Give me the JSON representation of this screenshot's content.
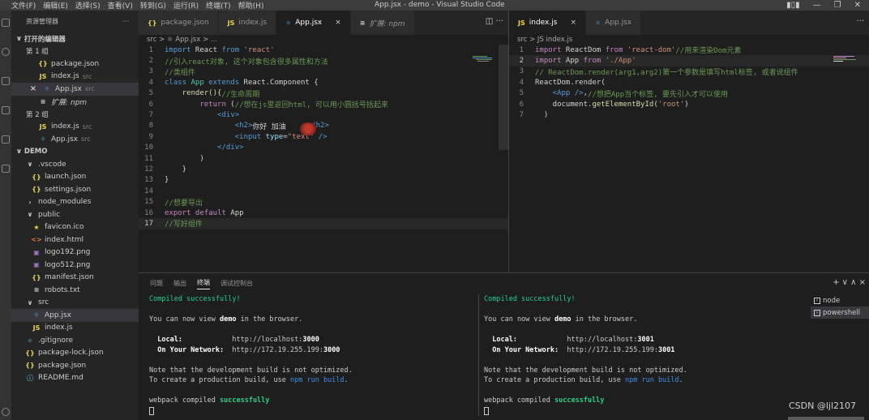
{
  "titlebar": {
    "menus": [
      "文件(F)",
      "编辑(E)",
      "选择(S)",
      "查看(V)",
      "转到(G)",
      "运行(R)",
      "终端(T)",
      "帮助(H)"
    ],
    "title": "App.jsx - demo - Visual Studio Code"
  },
  "sidebar": {
    "header": "资源管理器",
    "more": "···",
    "open_editors": "打开的编辑器",
    "group1": "第 1 组",
    "group1_items": [
      {
        "icon": "{}",
        "name": "package.json",
        "hint": ""
      },
      {
        "icon": "JS",
        "name": "index.js",
        "hint": "src"
      },
      {
        "icon": "×",
        "name": "App.jsx",
        "hint": "src"
      },
      {
        "icon": "≡",
        "name": "扩展: npm",
        "hint": ""
      }
    ],
    "group2": "第 2 组",
    "group2_items": [
      {
        "icon": "JS",
        "name": "index.js",
        "hint": "src"
      },
      {
        "icon": "⚛",
        "name": "App.jsx",
        "hint": "src"
      }
    ],
    "project": "DEMO",
    "tree": [
      {
        "icon": "∨",
        "name": ".vscode"
      },
      {
        "icon": "{}",
        "name": "launch.json"
      },
      {
        "icon": "{}",
        "name": "settings.json"
      },
      {
        "icon": "›",
        "name": "node_modules"
      },
      {
        "icon": "∨",
        "name": "public"
      },
      {
        "icon": "★",
        "name": "favicon.ico"
      },
      {
        "icon": "<>",
        "name": "index.html"
      },
      {
        "icon": "▣",
        "name": "logo192.png"
      },
      {
        "icon": "▣",
        "name": "logo512.png"
      },
      {
        "icon": "{}",
        "name": "manifest.json"
      },
      {
        "icon": "≡",
        "name": "robots.txt"
      },
      {
        "icon": "∨",
        "name": "src"
      },
      {
        "icon": "⚛",
        "name": "App.jsx"
      },
      {
        "icon": "JS",
        "name": "index.js"
      },
      {
        "icon": "◆",
        "name": ".gitignore"
      },
      {
        "icon": "{}",
        "name": "package-lock.json"
      },
      {
        "icon": "{}",
        "name": "package.json"
      },
      {
        "icon": "ⓘ",
        "name": "README.md"
      }
    ]
  },
  "editor1": {
    "tabs": [
      {
        "icon": "{}",
        "label": "package.json"
      },
      {
        "icon": "JS",
        "label": "index.js"
      },
      {
        "icon": "⚛",
        "label": "App.jsx"
      },
      {
        "icon": "≡",
        "label": "扩展: npm"
      }
    ],
    "close": "×",
    "actions": "◫  ···",
    "breadcrumb": "src > ⚛ App.jsx > ...",
    "line_numbers": [
      "1",
      "2",
      "3",
      "4",
      "5",
      "6",
      "7",
      "8",
      "9",
      "10",
      "11",
      "12",
      "13",
      "14",
      "15",
      "16",
      "17"
    ],
    "tokens": {
      "l1": [
        "import",
        " React ",
        "from",
        " 'react'"
      ],
      "l2": "//引入react对象, 这个对象包含很多属性和方法",
      "l3": "//类组件",
      "l4": [
        "class",
        " App ",
        "extends",
        " React.Component {"
      ],
      "l5": [
        "    render(){",
        "//生命周期"
      ],
      "l6": [
        "        return",
        " (",
        "//想在js里返回html, 可以用小圆括号括起来"
      ],
      "l7": [
        "            <div>"
      ],
      "l8": [
        "                <h2>",
        "你好 加油",
        "</h2>"
      ],
      "l9": [
        "                <input ",
        "type",
        "=",
        "\"text\"",
        " />"
      ],
      "l10": [
        "            </div>"
      ],
      "l11": "        )",
      "l12": "    }",
      "l13": "}",
      "l14": "",
      "l15": "//想要导出",
      "l16": [
        "export",
        " default",
        " App"
      ],
      "l17": "//写好组件"
    }
  },
  "editor2": {
    "tabs": [
      {
        "icon": "JS",
        "label": "index.js"
      },
      {
        "icon": "⚛",
        "label": "App.jsx"
      }
    ],
    "close": "×",
    "actions": "···",
    "breadcrumb": "src > JS index.js",
    "line_numbers": [
      "1",
      "2",
      "3",
      "4",
      "5",
      "6",
      "7"
    ],
    "tokens": {
      "l1": [
        "import",
        " ReactDom ",
        "from",
        " 'react-dom'",
        "//用来渲染Dom元素"
      ],
      "l2": [
        "import",
        " App ",
        "from",
        " './App'"
      ],
      "l3": "// ReactDom.render(arg1,arg2)第一个参数是填写html标签, 或者说组件",
      "l4": [
        "ReactDom.render("
      ],
      "l5": [
        "    <App />",
        ",",
        "//想把App当个标签, 要先引入才可以使用"
      ],
      "l6": [
        "    document.",
        "getElementById",
        "(",
        "'root'",
        ")"
      ],
      "l7": "  )"
    }
  },
  "panel": {
    "tabs": [
      "问题",
      "输出",
      "终端",
      "调试控制台"
    ],
    "actions": "+ ∨  ∧  ×",
    "terminal_list": [
      "node",
      "powershell"
    ],
    "term1": {
      "compiled": "Compiled successfully!",
      "view_pre": "You can now view ",
      "view_app": "demo",
      "view_post": " in the browser.",
      "local_label": "  Local:",
      "local_url_pre": "            http://localhost:",
      "local_port": "3000",
      "network_label": "  On Your Network:",
      "network_url_pre": "  http://172.19.255.199:",
      "network_port": "3000",
      "note1": "Note that the development build is not optimized.",
      "note2_pre": "To create a production build, use ",
      "note2_cmd": "npm run build",
      "note2_post": ".",
      "webpack_pre": "webpack compiled ",
      "webpack_ok": "successfully"
    },
    "term2": {
      "compiled": "Compiled successfully!",
      "view_pre": "You can now view ",
      "view_app": "demo",
      "view_post": " in the browser.",
      "local_label": "  Local:",
      "local_url_pre": "            http://localhost:",
      "local_port": "3001",
      "network_label": "  On Your Network:",
      "network_url_pre": "  http://172.19.255.199:",
      "network_port": "3001",
      "note1": "Note that the development build is not optimized.",
      "note2_pre": "To create a production build, use ",
      "note2_cmd": "npm run build",
      "note2_post": ".",
      "webpack_pre": "webpack compiled ",
      "webpack_ok": "successfully"
    }
  },
  "watermark": "CSDN @ljl2107"
}
